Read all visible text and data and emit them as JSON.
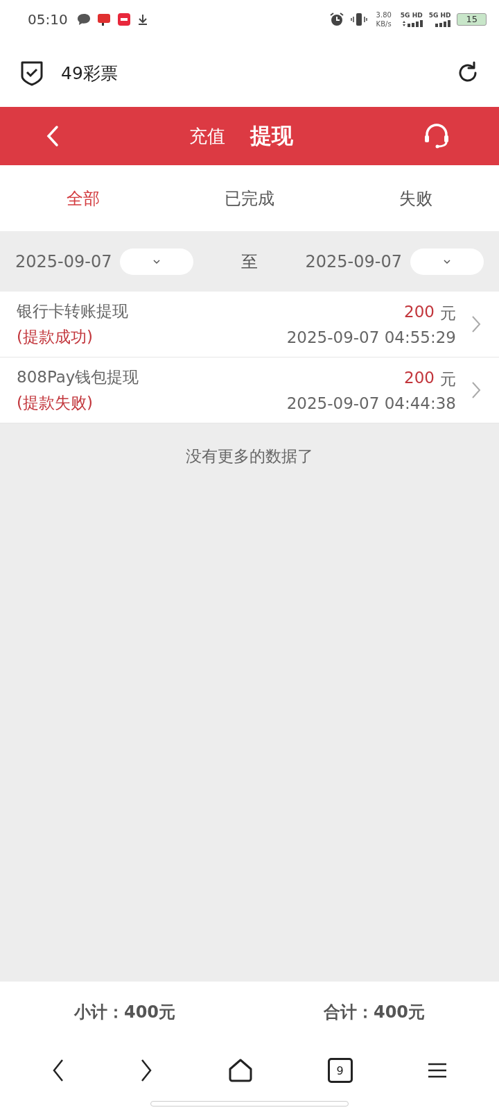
{
  "status_bar": {
    "time": "05:10",
    "speed_value": "3.80",
    "speed_unit": "KB/s",
    "network_1": "5G HD",
    "network_2": "5G HD",
    "battery": "15"
  },
  "app_bar": {
    "title": "49彩票"
  },
  "header_tabs": [
    {
      "label": "充值",
      "selected": false
    },
    {
      "label": "提现",
      "selected": true
    }
  ],
  "filter_tabs": [
    {
      "label": "全部",
      "selected": true
    },
    {
      "label": "已完成",
      "selected": false
    },
    {
      "label": "失败",
      "selected": false
    }
  ],
  "date_range": {
    "from": "2025-09-07",
    "separator": "至",
    "to": "2025-09-07"
  },
  "records": [
    {
      "title": "银行卡转账提现",
      "status": "(提款成功)",
      "amount": "200",
      "unit": "元",
      "time": "2025-09-07 04:55:29"
    },
    {
      "title": "808Pay钱包提现",
      "status": "(提款失败)",
      "amount": "200",
      "unit": "元",
      "time": "2025-09-07 04:44:38"
    }
  ],
  "end_message": "没有更多的数据了",
  "summary": {
    "subtotal": "小计：400元",
    "total": "合计：400元"
  },
  "nav_bar": {
    "tab_count": "9"
  }
}
